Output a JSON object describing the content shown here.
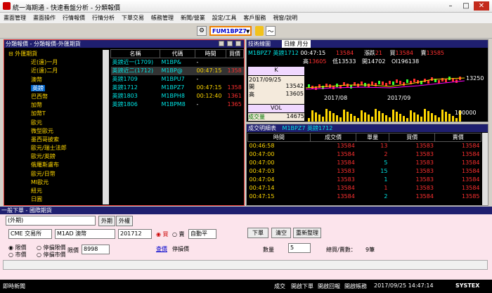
{
  "window": {
    "title": "統一海期通 - 快速看盤分析 - 分類報價"
  },
  "menu": [
    "畫面管理",
    "畫面操作",
    "行情報價",
    "行情分析",
    "下單交易",
    "帳務管理",
    "新聞/營業",
    "設定/工具",
    "客戶服務",
    "視窗/說明"
  ],
  "toolbar": {
    "symbol": "FUM1BPZ7"
  },
  "quote_panel": {
    "title": "分類報價 - 分類報價-外匯期貨",
    "tree": [
      "外匯期貨",
      "近(遠)一月",
      "近(遠)二月",
      "澳幣",
      "英鎊",
      "巴西幣",
      "加幣",
      "加幣T",
      "歐元",
      "微型歐元",
      "墨西哥披索",
      "歐元/瑞士法郎",
      "歐元/英鎊",
      "俄羅斯盧布",
      "歐元/日幣",
      "MI歐元",
      "紐元",
      "日圓"
    ],
    "headers": [
      "名稱",
      "代碼",
      "時間",
      "買價"
    ],
    "rows": [
      {
        "name": "英鎊近一(1709)",
        "code": "M1BP&",
        "time": "-",
        "bid": ""
      },
      {
        "name": "英鎊近二(1712)",
        "code": "M1BP@",
        "time": "00:47:15",
        "bid": "1358"
      },
      {
        "name": "英鎊1709",
        "code": "M1BPU7",
        "time": "-",
        "bid": ""
      },
      {
        "name": "英鎊1712",
        "code": "M1BPZ7",
        "time": "00:47:15",
        "bid": "1358"
      },
      {
        "name": "英鎊1803",
        "code": "M1BPH8",
        "time": "00:12:40",
        "bid": "1361"
      },
      {
        "name": "英鎊1806",
        "code": "M1BPM8",
        "time": "-",
        "bid": "1365"
      }
    ]
  },
  "chart_panel": {
    "title": "技術線圖",
    "period": "日線 月分",
    "symbol": "M1BPZ7",
    "name": "英鎊1712",
    "time": "00:47:15",
    "last": "13584",
    "change_label": "漲跌",
    "change": "21",
    "bid_label": "買",
    "bid": "13584",
    "ask_label": "賣",
    "ask": "13585",
    "high_label": "高",
    "high": "13605",
    "low_label": "低",
    "low": "13533",
    "open_label": "開",
    "open": "14702",
    "oi_label": "OI",
    "oi": "196138",
    "k_label": "K",
    "date": "2017/09/25",
    "k_open_label": "開",
    "k_open": "13542",
    "k_high_label": "高",
    "k_high": "13605",
    "price_axis": "13250",
    "dates": [
      "2017/08",
      "2017/09"
    ],
    "vol_label": "VOL",
    "vol_name": "成交量",
    "vol_value": "14675",
    "vol_axis": "100000"
  },
  "chart_data": {
    "type": "candlestick",
    "x": [
      "2017/08",
      "2017/09"
    ],
    "yticks": [
      "13250"
    ],
    "volume_ticks": [
      "100000"
    ]
  },
  "tick_panel": {
    "title": "成交明細表",
    "symbol": "M1BPZ7",
    "name": "英鎊1712",
    "headers": [
      "時間",
      "成交價",
      "單量",
      "買價",
      "賣價"
    ],
    "rows": [
      {
        "time": "00:46:58",
        "price": "13584",
        "qty": "13",
        "bid": "13583",
        "ask": "13584"
      },
      {
        "time": "00:47:00",
        "price": "13584",
        "qty": "2",
        "bid": "13583",
        "ask": "13584"
      },
      {
        "time": "00:47:00",
        "price": "13584",
        "qty": "5",
        "bid": "13583",
        "ask": "13584"
      },
      {
        "time": "00:47:03",
        "price": "13583",
        "qty": "15",
        "bid": "13583",
        "ask": "13584"
      },
      {
        "time": "00:47:04",
        "price": "13583",
        "qty": "1",
        "bid": "13583",
        "ask": "13584"
      },
      {
        "time": "00:47:14",
        "price": "13584",
        "qty": "1",
        "bid": "13583",
        "ask": "13584"
      },
      {
        "time": "00:47:15",
        "price": "13584",
        "qty": "2",
        "bid": "13584",
        "ask": "13585"
      }
    ]
  },
  "order_panel": {
    "title": "一般下單 - 國際期貨",
    "tabs": [
      "外期",
      "外權"
    ],
    "exchange": "CME 交易所",
    "contract": "M1AD 澳幣",
    "month": "201712",
    "buy_label": "買",
    "sell_label": "賣",
    "auto_label": "自動平",
    "submit": "下單",
    "clear": "清空",
    "confirm": "重新整理",
    "limit_label": "限價",
    "market_label": "市價",
    "stop_limit_label": "停損限價",
    "stop_market_label": "停損市價",
    "price_label": "限價",
    "price_value": "8998",
    "query_label": "查價",
    "stop_price_label": "停損價",
    "qty_label": "數量",
    "qty": "5",
    "hint_label": "總買/賣數：",
    "hint_value": "9筆"
  },
  "statusbar": {
    "news": "即時新聞",
    "items": [
      "成交",
      "開啟下單",
      "開啟回報",
      "開啟帳務"
    ],
    "clock": "2017/09/25 14:47:14",
    "brand": "SYSTEX"
  }
}
